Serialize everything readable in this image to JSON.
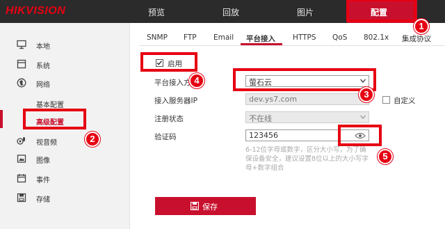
{
  "brand": "HIKVISION",
  "nav": [
    "预览",
    "回放",
    "图片",
    "配置"
  ],
  "sidebar": {
    "items": [
      "本地",
      "系统",
      "网络"
    ],
    "subitems": [
      "基本配置",
      "高级配置"
    ],
    "items2": [
      "视音频",
      "图像",
      "事件",
      "存储"
    ]
  },
  "tabs": [
    "SNMP",
    "FTP",
    "Email",
    "平台接入",
    "HTTPS",
    "QoS",
    "802.1x",
    "集成协议"
  ],
  "form": {
    "enable_label": "启用",
    "platform_label": "平台接入方式",
    "platform_value": "萤石云",
    "server_label": "接入服务器IP",
    "server_value": "dev.ys7.com",
    "custom_label": "自定义",
    "status_label": "注册状态",
    "status_value": "不在线",
    "code_label": "验证码",
    "code_value": "123456",
    "hint": "6-12位字母或数字，区分大小写，为了确保设备安全，建议设置8位以上的大小写字母+数字组合"
  },
  "save_label": "保存",
  "badges": [
    "1",
    "2",
    "3",
    "4",
    "5"
  ],
  "colors": {
    "accent": "#c8102e",
    "highlight": "#e60012",
    "topbar": "#2b2b2b"
  }
}
